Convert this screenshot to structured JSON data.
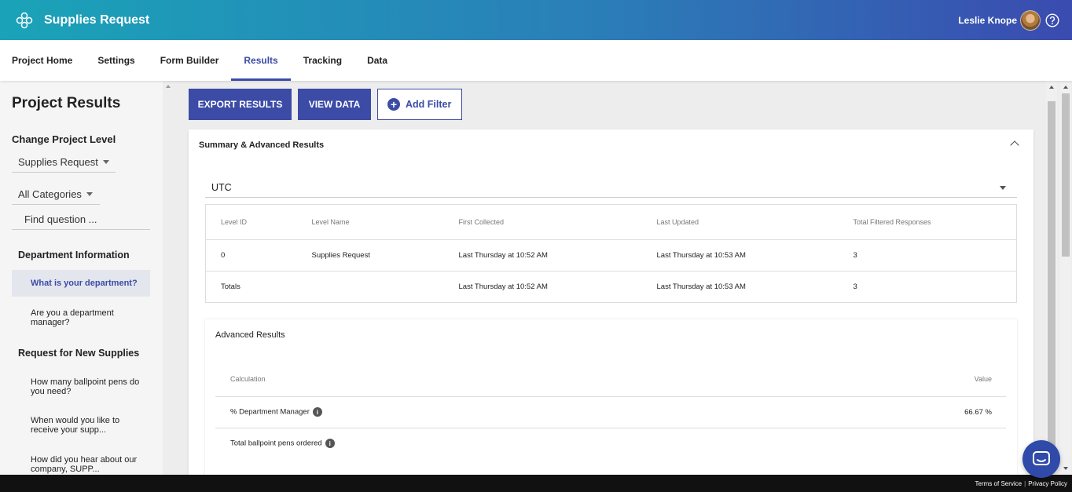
{
  "header": {
    "app_title": "Supplies Request",
    "user_name": "Leslie Knope"
  },
  "nav": {
    "tabs": [
      {
        "label": "Project Home"
      },
      {
        "label": "Settings"
      },
      {
        "label": "Form Builder"
      },
      {
        "label": "Results",
        "active": true
      },
      {
        "label": "Tracking"
      },
      {
        "label": "Data"
      }
    ]
  },
  "sidebar": {
    "title": "Project Results",
    "change_level_label": "Change Project Level",
    "level_select": "Supplies Request",
    "category_select": "All Categories",
    "find_placeholder": "Find question ...",
    "sections": [
      {
        "name": "Department Information",
        "items": [
          "What is your department?",
          "Are you a department manager?"
        ]
      },
      {
        "name": "Request for New Supplies",
        "items": [
          "How many ballpoint pens do you need?",
          "When would you like to receive your supp...",
          "How did you hear about our company, SUPP..."
        ]
      }
    ]
  },
  "toolbar": {
    "export_label": "EXPORT RESULTS",
    "view_data_label": "VIEW DATA",
    "add_filter_label": "Add Filter"
  },
  "summary": {
    "title": "Summary & Advanced Results",
    "timezone": "UTC",
    "columns": [
      "Level ID",
      "Level Name",
      "First Collected",
      "Last Updated",
      "Total Filtered Responses"
    ],
    "rows": [
      [
        "0",
        "Supplies Request",
        "Last Thursday at 10:52 AM",
        "Last Thursday at 10:53 AM",
        "3"
      ],
      [
        "Totals",
        "",
        "Last Thursday at 10:52 AM",
        "Last Thursday at 10:53 AM",
        "3"
      ]
    ]
  },
  "advanced": {
    "title": "Advanced Results",
    "columns": [
      "Calculation",
      "Value"
    ],
    "rows": [
      {
        "calculation": "% Department Manager",
        "value": "66.67 %"
      },
      {
        "calculation": "Total ballpoint pens ordered",
        "value": ""
      }
    ]
  },
  "footer": {
    "terms": "Terms of Service",
    "privacy": "Privacy Policy"
  },
  "colors": {
    "accent": "#3b4ba6",
    "header_start": "#1aa3b8",
    "header_end": "#3b4bb0"
  }
}
